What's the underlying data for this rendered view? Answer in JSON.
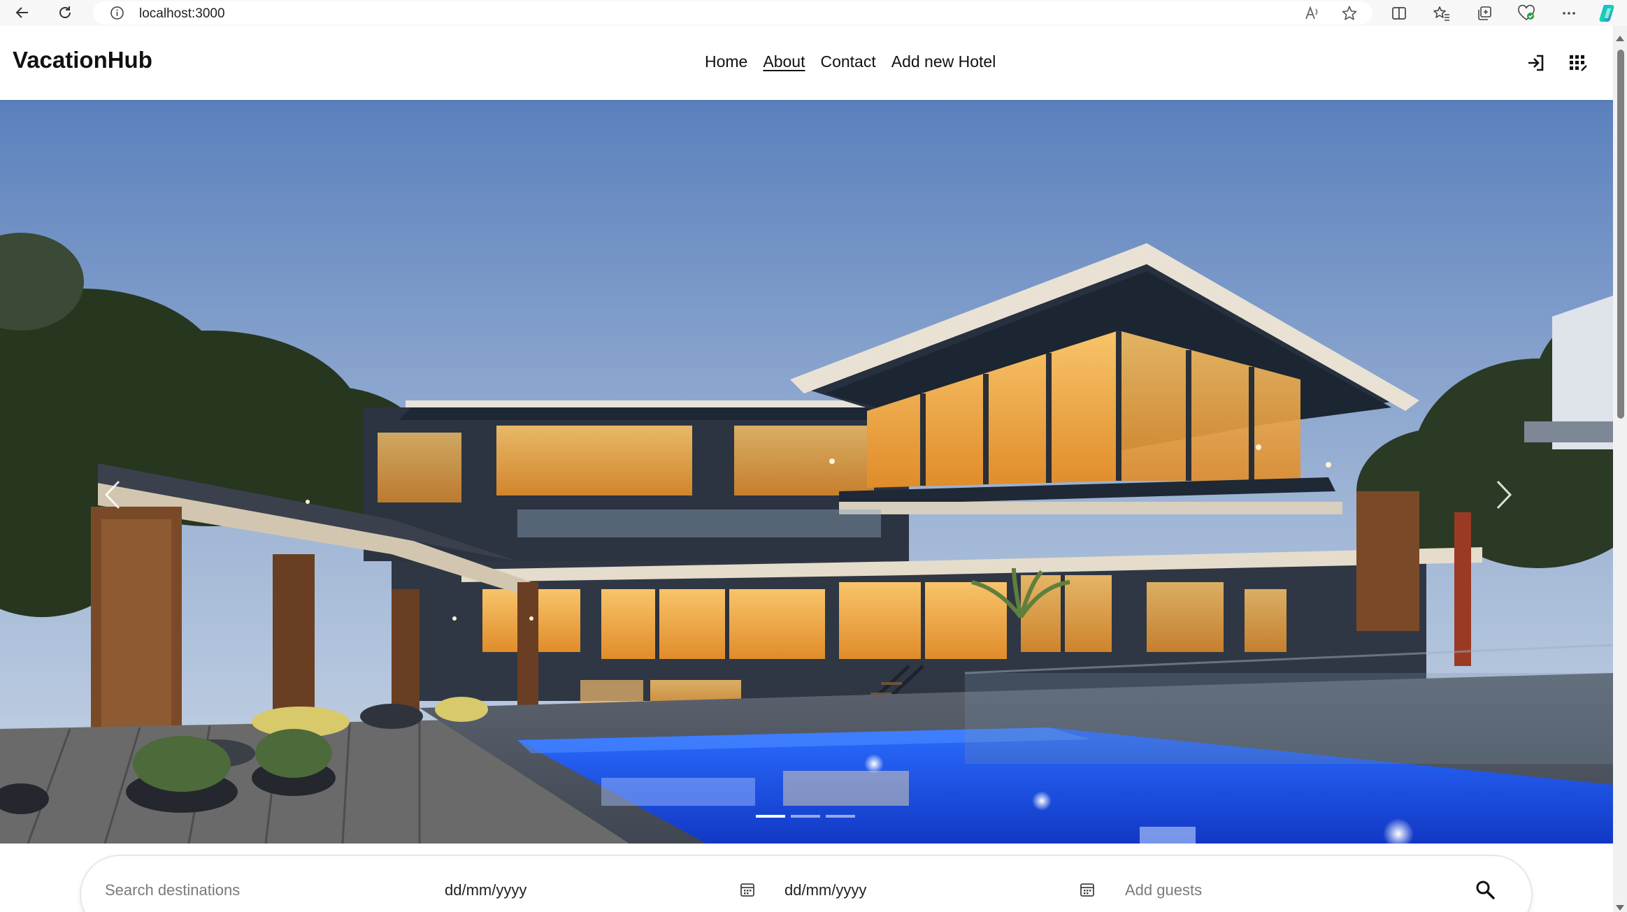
{
  "browser": {
    "url": "localhost:3000",
    "icons": [
      "back-icon",
      "refresh-icon",
      "info-icon",
      "read-aloud-icon",
      "favorite-star-icon",
      "split-screen-icon",
      "favorites-icon",
      "collections-icon",
      "browser-essentials-icon",
      "more-icon",
      "copilot-icon"
    ]
  },
  "header": {
    "brand": "VacationHub",
    "nav": [
      {
        "label": "Home"
      },
      {
        "label": "About",
        "active": true
      },
      {
        "label": "Contact"
      },
      {
        "label": "Add new Hotel"
      }
    ],
    "icons": [
      "login-icon",
      "apps-grid-icon"
    ]
  },
  "hero": {
    "image": "modern villa with lit glass walls and blue swimming pool at dusk",
    "slides": 3,
    "active_slide": 1,
    "icons": [
      "carousel-prev-icon",
      "carousel-next-icon"
    ]
  },
  "search": {
    "destination_placeholder": "Search destinations",
    "checkin_value": "dd/mm/yyyy",
    "checkout_value": "dd/mm/yyyy",
    "guests_placeholder": "Add guests",
    "icons": [
      "calendar-icon",
      "search-icon"
    ]
  },
  "colors": {
    "pool": "#1f5ff2",
    "sky_top": "#5a80bd",
    "sky_bottom": "#c9d6e5",
    "window_glow": "#f4b24a"
  }
}
